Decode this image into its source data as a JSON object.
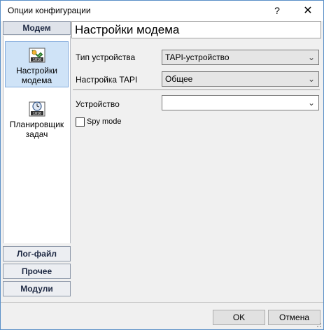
{
  "window": {
    "title": "Опции конфигурации",
    "help_label": "?",
    "close_label": "✕"
  },
  "sidebar": {
    "active_group": "Модем",
    "items": [
      {
        "label": "Настройки модема",
        "icon": "modem-settings-icon",
        "selected": true
      },
      {
        "label": "Планировщик задач",
        "icon": "scheduler-clock-icon",
        "selected": false
      }
    ],
    "groups": [
      {
        "label": "Лог-файл"
      },
      {
        "label": "Прочее"
      },
      {
        "label": "Модули"
      }
    ]
  },
  "main": {
    "header": "Настройки модема",
    "fields": {
      "device_type": {
        "label": "Тип устройства",
        "value": "TAPI-устройство"
      },
      "tapi_setting": {
        "label": "Настройка TAPI",
        "value": "Общее"
      },
      "device": {
        "label": "Устройство",
        "value": ""
      },
      "spy_mode": {
        "label": "Spy mode",
        "checked": false
      }
    }
  },
  "footer": {
    "ok_label": "OK",
    "cancel_label": "Отмена"
  },
  "colors": {
    "selection_bg": "#cfe3f7",
    "window_border": "#5a8fc7"
  }
}
